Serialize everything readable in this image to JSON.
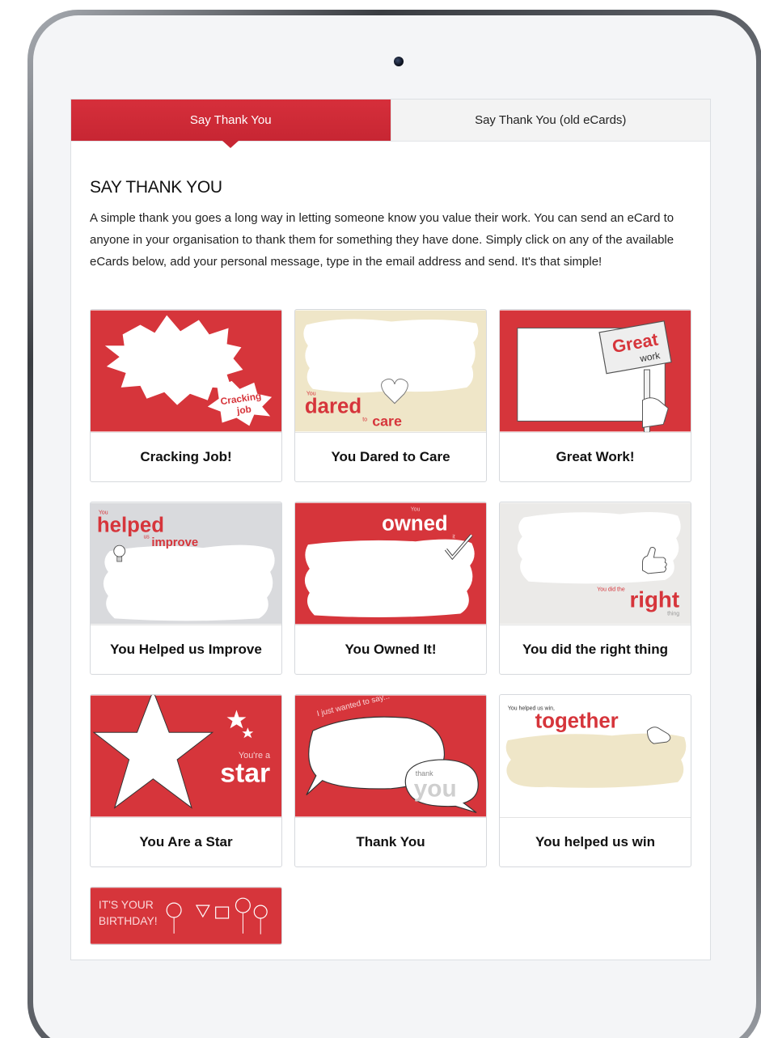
{
  "tabs": [
    {
      "label": "Say Thank You",
      "active": true
    },
    {
      "label": "Say Thank You (old eCards)",
      "active": false
    }
  ],
  "heading": "SAY THANK YOU",
  "intro": "A simple thank you goes a long way in letting someone know you value their work. You can send an eCard to anyone in your organisation to thank them for something they have done. Simply click on any of the available eCards below, add your personal message, type in the email address and send. It's that simple!",
  "colors": {
    "brand_red": "#d6353b",
    "cream": "#efe6c8",
    "grey": "#d9dadd"
  },
  "cards": [
    {
      "title": "Cracking Job!",
      "art": {
        "line1": "Cracking",
        "line2": "job"
      }
    },
    {
      "title": "You Dared to Care",
      "art": {
        "small1": "You",
        "word1": "dared",
        "small2": "to",
        "word2": "care"
      }
    },
    {
      "title": "Great Work!",
      "art": {
        "word1": "Great",
        "word2": "work"
      }
    },
    {
      "title": "You Helped us Improve",
      "art": {
        "small1": "You",
        "word1": "helped",
        "small2": "us",
        "word2": "improve"
      }
    },
    {
      "title": "You Owned It!",
      "art": {
        "small1": "You",
        "word1": "owned",
        "small2": "it"
      }
    },
    {
      "title": "You did the right thing",
      "art": {
        "small1": "You did the",
        "word1": "right",
        "small2": "thing"
      }
    },
    {
      "title": "You Are a Star",
      "art": {
        "small1": "You're a",
        "word1": "star"
      }
    },
    {
      "title": "Thank You",
      "art": {
        "small1": "I just wanted to say...",
        "small2": "thank",
        "word1": "you"
      }
    },
    {
      "title": "You helped us win",
      "art": {
        "small1": "You helped us win,",
        "word1": "together"
      }
    },
    {
      "title": "",
      "art": {
        "line1": "IT'S YOUR",
        "line2": "BIRTHDAY!"
      }
    }
  ]
}
